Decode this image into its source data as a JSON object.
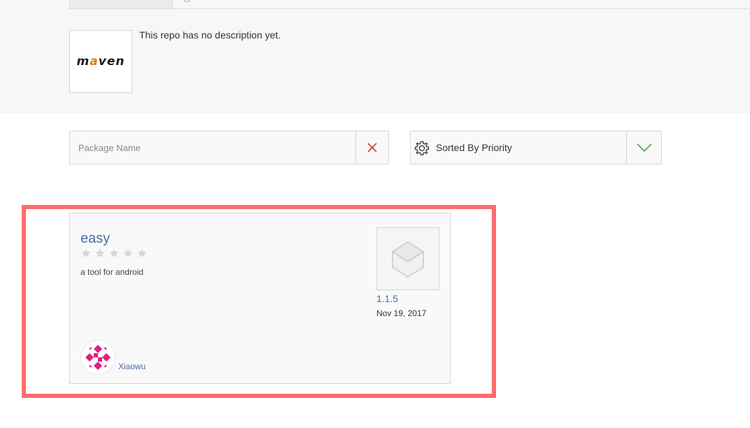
{
  "repo": {
    "logo_text_pre": "m",
    "logo_text_accent": "a",
    "logo_text_post": "ven",
    "description": "This repo has no description yet."
  },
  "filters": {
    "search_placeholder": "Package Name",
    "search_value": "",
    "sort_label": "Sorted By Priority"
  },
  "package": {
    "name": "easy",
    "rating": 0,
    "rating_max": 5,
    "description": "a tool for android",
    "version": "1.1.5",
    "date": "Nov 19, 2017",
    "author": "Xiaowu"
  },
  "icons": {
    "clear": "close-icon",
    "sort": "gear-icon",
    "toggle": "chevron-down-icon",
    "thumb": "package-box-icon",
    "star": "star-icon"
  },
  "colors": {
    "link": "#4a6ea8",
    "highlight": "#ff6b6b",
    "clear": "#d33b3b",
    "toggle": "#4caf50",
    "avatar_accent": "#e0207e"
  }
}
